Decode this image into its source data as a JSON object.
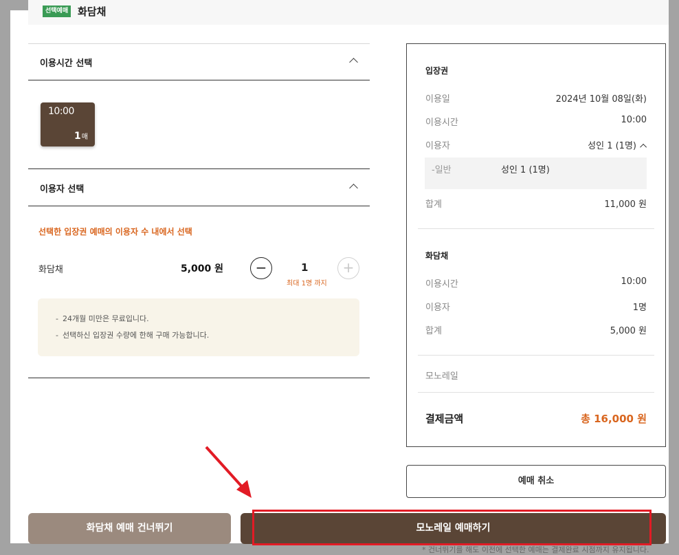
{
  "header": {
    "badge": "선택예매",
    "title": "화담채"
  },
  "time_section": {
    "title": "이용시간 선택",
    "card_time": "10:00",
    "card_count": "1",
    "card_unit": "매"
  },
  "user_section": {
    "title": "이용자 선택",
    "notice": "선택한 입장권 예매의 이용자 수 내에서 선택",
    "ticket_name": "화담채",
    "ticket_price": "5,000 원",
    "quantity": "1",
    "max_note": "최대 1명 까지",
    "info": [
      "24개월 미만은 무료입니다.",
      "선택하신 입장권 수량에 한해 구매 가능합니다."
    ]
  },
  "summary": {
    "entry": {
      "title": "입장권",
      "date_label": "이용일",
      "date_value": "2024년 10월 08일(화)",
      "time_label": "이용시간",
      "time_value": "10:00",
      "user_label": "이용자",
      "user_value": "성인 1 (1명)",
      "sub_label": "-일반",
      "sub_value": "성인 1 (1명)",
      "total_label": "합계",
      "total_value": "11,000 원"
    },
    "hwadam": {
      "title": "화담채",
      "time_label": "이용시간",
      "time_value": "10:00",
      "user_label": "이용자",
      "user_value": "1명",
      "total_label": "합계",
      "total_value": "5,000 원"
    },
    "monorail_label": "모노레일",
    "pay_label": "결제금액",
    "pay_value": "총 16,000 원"
  },
  "buttons": {
    "cancel": "예매 취소",
    "skip": "화담채 예매 건너뛰기",
    "book": "모노레일 예매하기"
  },
  "cut_note": "* 건너뛰기를 해도 이전에 선택한 예매는 결제완료 시점까지 유지됩니다."
}
